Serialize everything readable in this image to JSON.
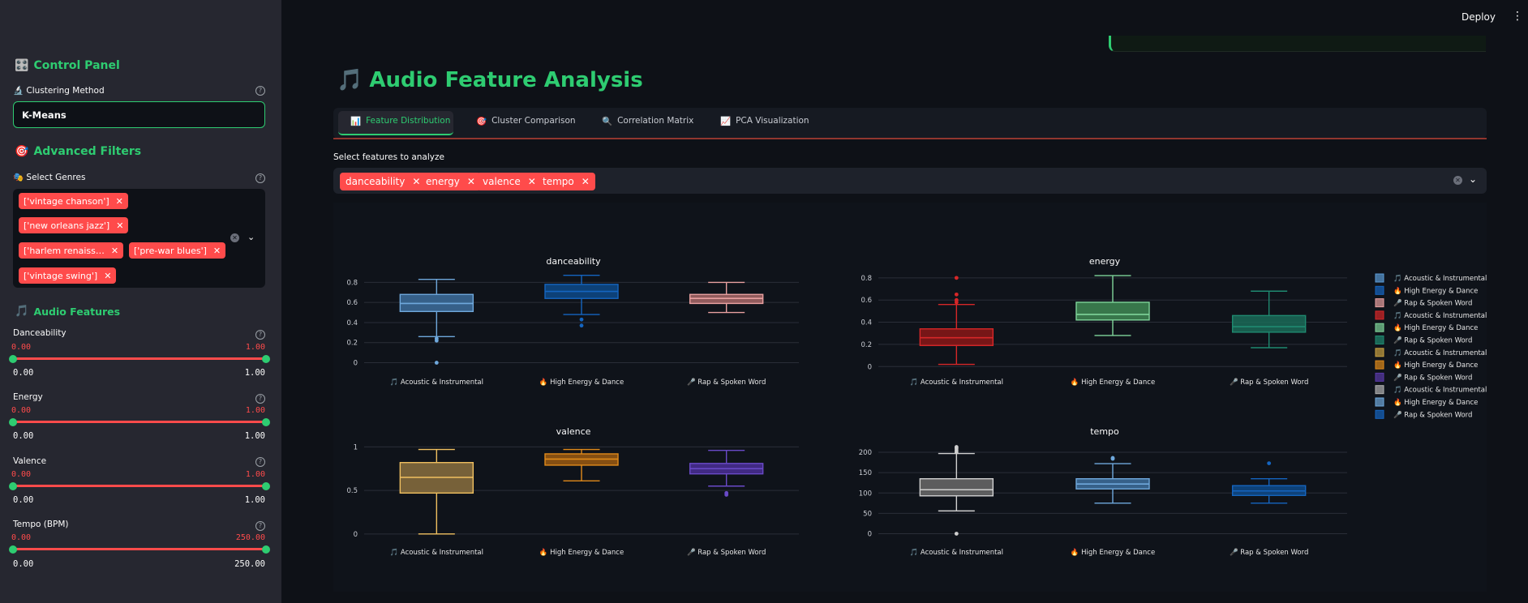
{
  "topbar": {
    "deploy_label": "Deploy",
    "menu_icon": "⋮"
  },
  "sidebar": {
    "control_panel_title": "Control Panel",
    "clustering_label": "Clustering Method",
    "clustering_value": "K-Means",
    "advanced_title": "Advanced Filters",
    "genres_label": "Select Genres",
    "genres": [
      "['vintage chanson']",
      "['new orleans jazz']",
      "['harlem renaiss…",
      "['pre-war blues']",
      "['vintage swing']"
    ],
    "audio_title": "Audio Features",
    "sliders": [
      {
        "label": "Danceability",
        "low": "0.00",
        "high": "1.00",
        "min": "0.00",
        "max": "1.00"
      },
      {
        "label": "Energy",
        "low": "0.00",
        "high": "1.00",
        "min": "0.00",
        "max": "1.00"
      },
      {
        "label": "Valence",
        "low": "0.00",
        "high": "1.00",
        "min": "0.00",
        "max": "1.00"
      },
      {
        "label": "Tempo (BPM)",
        "low": "0.00",
        "high": "250.00",
        "min": "0.00",
        "max": "250.00"
      }
    ]
  },
  "main": {
    "title": "Audio Feature Analysis",
    "tabs": [
      {
        "label": "Feature Distribution",
        "icon": "📊"
      },
      {
        "label": "Cluster Comparison",
        "icon": "🎯"
      },
      {
        "label": "Correlation Matrix",
        "icon": "🔍"
      },
      {
        "label": "PCA Visualization",
        "icon": "📈"
      }
    ],
    "select_features_label": "Select features to analyze",
    "features": [
      "danceability",
      "energy",
      "valence",
      "tempo"
    ]
  },
  "chart_data": {
    "type": "box",
    "categories": [
      "🎵 Acoustic & Instrumental",
      "🔥 High Energy & Dance",
      "🎤 Rap & Spoken Word"
    ],
    "legend": [
      {
        "name": "🎵 Acoustic & Instrumental",
        "color": "#5b9bd5"
      },
      {
        "name": "🔥 High Energy & Dance",
        "color": "#1565c0"
      },
      {
        "name": "🎤 Rap & Spoken Word",
        "color": "#e8a0a0"
      },
      {
        "name": "🎵 Acoustic & Instrumental",
        "color": "#d62728"
      },
      {
        "name": "🔥 High Energy & Dance",
        "color": "#7fd49a"
      },
      {
        "name": "🎤 Rap & Spoken Word",
        "color": "#1f8a70"
      },
      {
        "name": "🎵 Acoustic & Instrumental",
        "color": "#c8a040"
      },
      {
        "name": "🔥 High Energy & Dance",
        "color": "#e08a1a"
      },
      {
        "name": "🎤 Rap & Spoken Word",
        "color": "#5a3aa8"
      },
      {
        "name": "🎵 Acoustic & Instrumental",
        "color": "#b0b0b0"
      },
      {
        "name": "🔥 High Energy & Dance",
        "color": "#6fa8dc"
      },
      {
        "name": "🎤 Rap & Spoken Word",
        "color": "#1565c0"
      }
    ],
    "subplots": [
      {
        "title": "danceability",
        "yticks": [
          0,
          0.2,
          0.4,
          0.6,
          0.8
        ],
        "ylim": [
          -0.02,
          0.9
        ],
        "boxes": [
          {
            "min": 0.26,
            "q1": 0.51,
            "median": 0.59,
            "q3": 0.68,
            "max": 0.83,
            "outliers": [
              0.22,
              0.24,
              0.0
            ],
            "color": "#6fa8dc",
            "fill": "#3d6e9e"
          },
          {
            "min": 0.48,
            "q1": 0.64,
            "median": 0.71,
            "q3": 0.78,
            "max": 0.87,
            "outliers": [
              0.43,
              0.37
            ],
            "color": "#1565c0",
            "fill": "#0d4a8a"
          },
          {
            "min": 0.5,
            "q1": 0.59,
            "median": 0.64,
            "q3": 0.68,
            "max": 0.8,
            "outliers": [],
            "color": "#e8a0a0",
            "fill": "#a86868"
          }
        ]
      },
      {
        "title": "energy",
        "yticks": [
          0,
          0.2,
          0.4,
          0.6,
          0.8
        ],
        "ylim": [
          -0.02,
          0.85
        ],
        "boxes": [
          {
            "min": 0.02,
            "q1": 0.19,
            "median": 0.26,
            "q3": 0.34,
            "max": 0.56,
            "outliers": [
              0.58,
              0.6,
              0.65,
              0.8
            ],
            "color": "#d62728",
            "fill": "#8a1818"
          },
          {
            "min": 0.28,
            "q1": 0.42,
            "median": 0.47,
            "q3": 0.58,
            "max": 0.82,
            "outliers": [],
            "color": "#7fd49a",
            "fill": "#3f8a55"
          },
          {
            "min": 0.17,
            "q1": 0.31,
            "median": 0.36,
            "q3": 0.46,
            "max": 0.68,
            "outliers": [],
            "color": "#1f8a70",
            "fill": "#1a6b58"
          }
        ]
      },
      {
        "title": "valence",
        "yticks": [
          0,
          0.5,
          1
        ],
        "ylim": [
          -0.02,
          1.05
        ],
        "boxes": [
          {
            "min": 0.0,
            "q1": 0.47,
            "median": 0.65,
            "q3": 0.82,
            "max": 0.97,
            "outliers": [],
            "color": "#f0c060",
            "fill": "#8a7040"
          },
          {
            "min": 0.61,
            "q1": 0.79,
            "median": 0.86,
            "q3": 0.92,
            "max": 0.97,
            "outliers": [],
            "color": "#e08a1a",
            "fill": "#9a5a12"
          },
          {
            "min": 0.55,
            "q1": 0.69,
            "median": 0.75,
            "q3": 0.81,
            "max": 0.96,
            "outliers": [
              0.45,
              0.47
            ],
            "color": "#6a4ac8",
            "fill": "#4a2f98"
          }
        ]
      },
      {
        "title": "tempo",
        "yticks": [
          0,
          50,
          100,
          150,
          200
        ],
        "ylim": [
          -5,
          220
        ],
        "boxes": [
          {
            "min": 56,
            "q1": 93,
            "median": 108,
            "q3": 135,
            "max": 197,
            "outliers": [
              0,
              200,
              205,
              210,
              213
            ],
            "color": "#cfcfcf",
            "fill": "#6a6a6a"
          },
          {
            "min": 75,
            "q1": 110,
            "median": 122,
            "q3": 135,
            "max": 172,
            "outliers": [
              184,
              186
            ],
            "color": "#6fa8dc",
            "fill": "#3d6e9e"
          },
          {
            "min": 75,
            "q1": 94,
            "median": 105,
            "q3": 118,
            "max": 135,
            "outliers": [
              173
            ],
            "color": "#1565c0",
            "fill": "#0d4a8a"
          }
        ]
      }
    ]
  }
}
